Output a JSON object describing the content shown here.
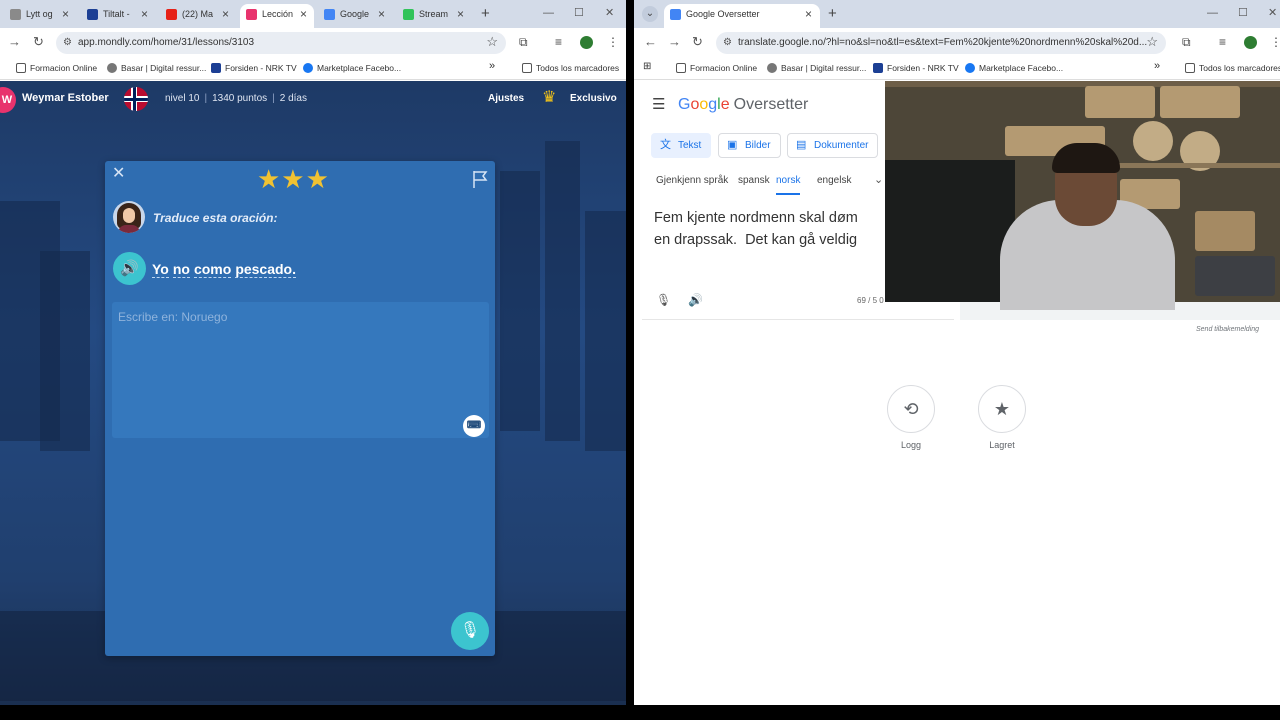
{
  "left_window": {
    "tabs": [
      {
        "label": "Lytt og"
      },
      {
        "label": "Tiltalt -"
      },
      {
        "label": "(22) Ma"
      },
      {
        "label": "Lección"
      },
      {
        "label": "Google"
      },
      {
        "label": "Stream"
      }
    ],
    "url": "app.mondly.com/home/31/lessons/3103",
    "bookmarks": [
      "Formacion Online",
      "Basar | Digital ressur...",
      "Forsiden - NRK TV",
      "Marketplace Facebo..."
    ],
    "all_bookmarks": "Todos los marcadores"
  },
  "mondly": {
    "avatar_initial": "W",
    "user_name": "Weymar Estober",
    "level": "nivel 10",
    "points": "1340 puntos",
    "streak": "2 días",
    "settings": "Ajustes",
    "exclusive": "Exclusivo",
    "instruction": "Traduce esta oración:",
    "sentence_words": [
      "Yo",
      "no",
      "como",
      "pescado."
    ],
    "answer_placeholder": "Escribe en: Noruego",
    "stars": "★★★"
  },
  "right_window": {
    "tab_label": "Google Oversetter",
    "url": "translate.google.no/?hl=no&sl=no&tl=es&text=Fem%20kjente%20nordmenn%20skal%20d...",
    "bookmarks": [
      "Formacion Online",
      "Basar | Digital ressur...",
      "Forsiden - NRK TV",
      "Marketplace Facebo..."
    ],
    "all_bookmarks": "Todos los marcadores"
  },
  "translate": {
    "logo_letters": [
      "G",
      "o",
      "o",
      "g",
      "l",
      "e"
    ],
    "logo_suffix": "Oversetter",
    "mode_tabs": [
      "Tekst",
      "Bilder",
      "Dokumenter"
    ],
    "languages": [
      "Gjenkjenn språk",
      "spansk",
      "norsk",
      "engelsk"
    ],
    "source_text": "Fem kjente nordmenn skal døm\nen drapssak.  Det kan gå veldig",
    "char_count": "69 / 5 0",
    "feedback": "Send tilbakemelding",
    "history_label": "Logg",
    "saved_label": "Lagret"
  },
  "colors": {
    "mondly_bg": "#244a82",
    "card": "#2f6db1",
    "teal": "#3cc4cf",
    "google_blue": "#1a73e8",
    "star": "#f1c232"
  }
}
